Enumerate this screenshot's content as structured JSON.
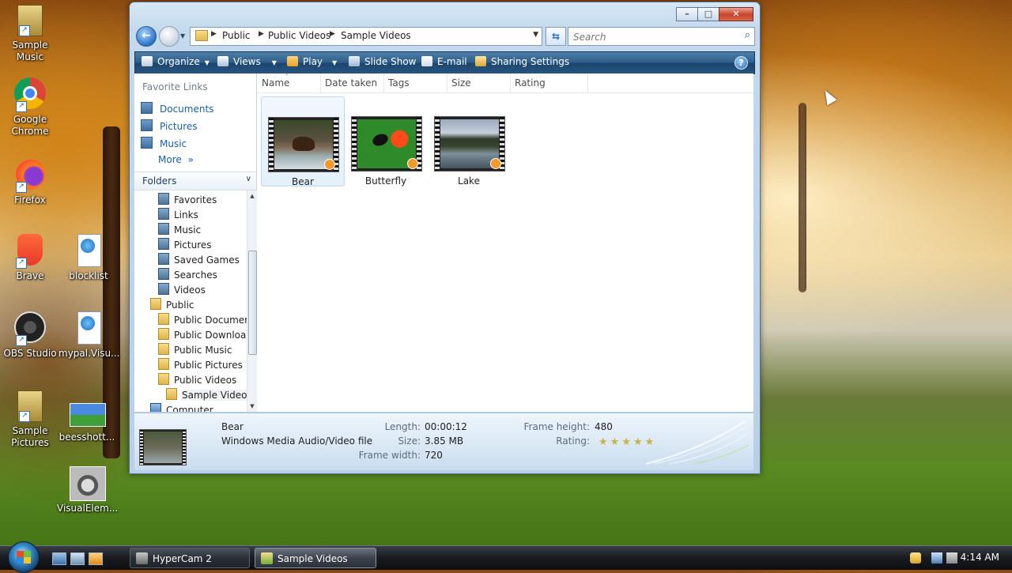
{
  "desktop": {
    "icons": [
      {
        "label": "Sample\nMusic"
      },
      {
        "label": "Google\nChrome"
      },
      {
        "label": "Firefox"
      },
      {
        "label": "Brave"
      },
      {
        "label": "blocklist"
      },
      {
        "label": "OBS Studio"
      },
      {
        "label": "mypal.Visu..."
      },
      {
        "label": "Sample\nPictures"
      },
      {
        "label": "beesshott..."
      },
      {
        "label": "VisualElem..."
      }
    ]
  },
  "window": {
    "title_buttons": {
      "minimize": "–",
      "maximize": "□",
      "close": "✕"
    },
    "address": {
      "crumbs": [
        "Public",
        "Public Videos",
        "Sample Videos"
      ],
      "separator": "▶",
      "dropdown": "▼"
    },
    "nav": {
      "back": "←",
      "history": "▼",
      "refresh": "⇆"
    },
    "search": {
      "placeholder": "Search",
      "icon": "search-icon"
    },
    "toolbar": {
      "organize": "Organize",
      "views": "Views",
      "play": "Play",
      "slideshow": "Slide Show",
      "email": "E-mail",
      "sharing": "Sharing Settings",
      "help": "?",
      "dropdown": "▼"
    },
    "nav_pane": {
      "favorites_title": "Favorite Links",
      "favorite_links": [
        "Documents",
        "Pictures",
        "Music"
      ],
      "more": "More",
      "more_chevron": "»",
      "folders_title": "Folders",
      "folders_chevron": "∨",
      "tree": [
        "Favorites",
        "Links",
        "Music",
        "Pictures",
        "Saved Games",
        "Searches",
        "Videos",
        "Public",
        "Public Documer",
        "Public Downloa",
        "Public Music",
        "Public Pictures",
        "Public Videos",
        "Sample Video",
        "Computer"
      ],
      "scroll_up": "▲",
      "scroll_down": "▼"
    },
    "columns": [
      "Name",
      "Date taken",
      "Tags",
      "Size",
      "Rating"
    ],
    "sort_arrow": "˄",
    "files": [
      {
        "name": "Bear",
        "selected": true
      },
      {
        "name": "Butterfly",
        "selected": false
      },
      {
        "name": "Lake",
        "selected": false
      }
    ],
    "details": {
      "name": "Bear",
      "type": "Windows Media Audio/Video file",
      "length_label": "Length:",
      "length": "00:00:12",
      "size_label": "Size:",
      "size": "3.85 MB",
      "frame_width_label": "Frame width:",
      "frame_width": "720",
      "frame_height_label": "Frame height:",
      "frame_height": "480",
      "rating_label": "Rating:",
      "rating_stars": "★★★★★",
      "rating_value": 0
    }
  },
  "taskbar": {
    "buttons": [
      {
        "label": "HyperCam 2",
        "active": false
      },
      {
        "label": "Sample Videos",
        "active": true
      }
    ],
    "clock": "4:14 AM"
  },
  "colors": {
    "toolbar": "#2f5f89",
    "link": "#1b5ea8",
    "selection": "#e3effa"
  }
}
